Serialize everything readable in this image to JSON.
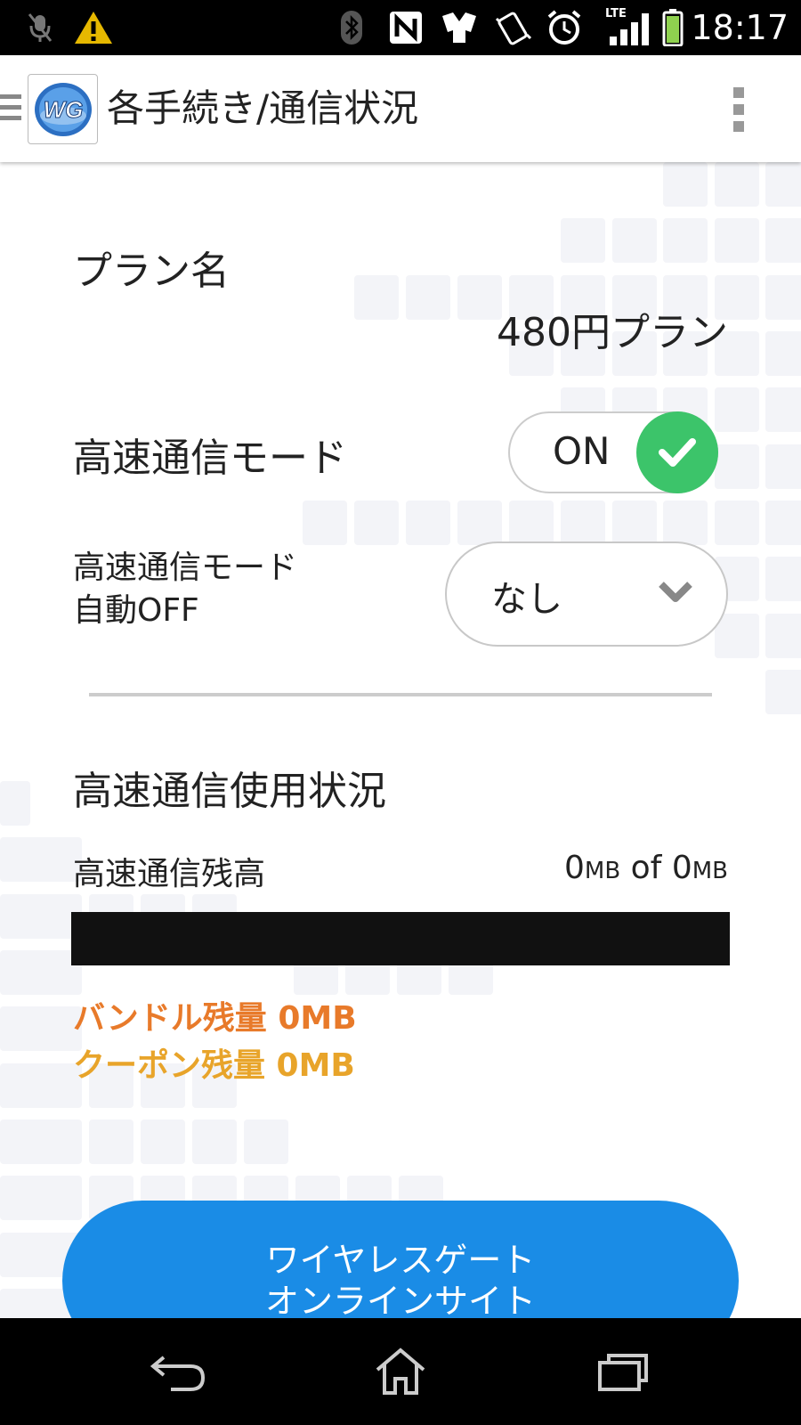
{
  "status_bar": {
    "time": "18:17",
    "network_label": "LTE",
    "icons": [
      "mic-off-icon",
      "warning-icon",
      "bluetooth-icon",
      "nfc-icon",
      "sim-icon",
      "vibrate-icon",
      "alarm-icon",
      "signal-icon",
      "battery-icon"
    ],
    "colors": {
      "warning": "#e6b800",
      "battery": "#8fd14f"
    }
  },
  "app_bar": {
    "logo_text": "WG",
    "title": "各手続き/通信状況"
  },
  "plan": {
    "label": "プラン名",
    "value": "480円プラン"
  },
  "high_speed_mode": {
    "label": "高速通信モード",
    "toggle_text": "ON",
    "toggle_on": true,
    "colors": {
      "knob": "#3cc46a"
    }
  },
  "auto_off": {
    "label_line1": "高速通信モード",
    "label_line2": "自動OFF",
    "selected": "なし"
  },
  "usage": {
    "section_title": "高速通信使用状況",
    "remaining_label": "高速通信残高",
    "used_value": "0",
    "used_unit": "MB",
    "of_text": "of",
    "total_value": "0",
    "total_unit": "MB",
    "progress_fraction": 0,
    "bundle_text": "バンドル残量 0MB",
    "coupon_text": "クーポン残量 0MB",
    "colors": {
      "bundle": "#e87a2a",
      "coupon": "#e8a42a",
      "bar": "#111111"
    }
  },
  "online_button": {
    "line1": "ワイヤレスゲート",
    "line2": "オンラインサイト",
    "colors": {
      "background": "#1a8ce6"
    }
  },
  "nav_bar": {
    "buttons": [
      "back-icon",
      "home-icon",
      "recents-icon"
    ]
  }
}
